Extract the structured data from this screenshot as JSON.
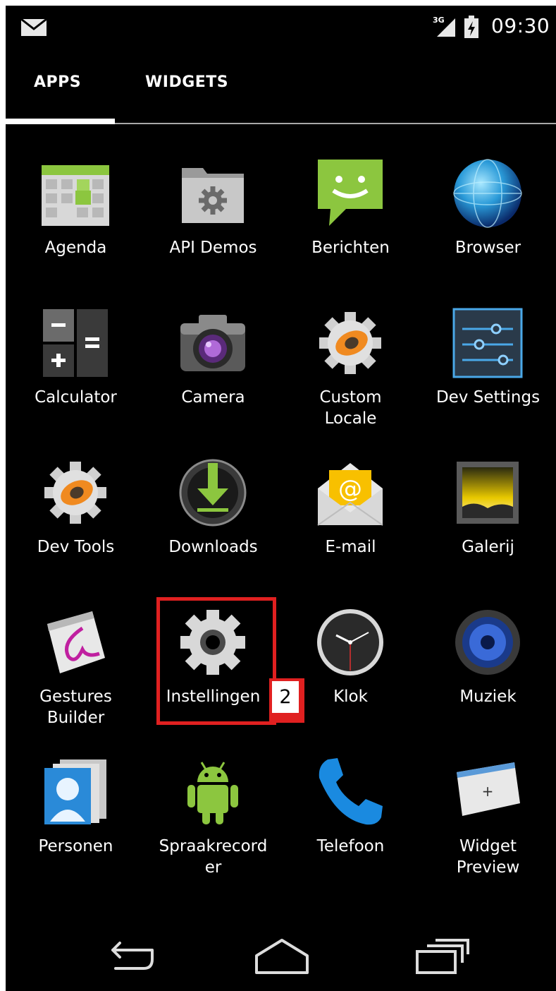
{
  "status_bar": {
    "network": "3G",
    "time": "09:30",
    "icons": [
      "mail-icon",
      "signal-icon",
      "battery-icon"
    ]
  },
  "tabs": [
    {
      "label": "APPS",
      "selected": true
    },
    {
      "label": "WIDGETS",
      "selected": false
    }
  ],
  "apps": [
    {
      "label": "Agenda",
      "icon": "calendar-icon"
    },
    {
      "label": "API Demos",
      "icon": "folder-gear-icon"
    },
    {
      "label": "Berichten",
      "icon": "messaging-icon"
    },
    {
      "label": "Browser",
      "icon": "globe-icon"
    },
    {
      "label": "Calculator",
      "icon": "calculator-icon"
    },
    {
      "label": "Camera",
      "icon": "camera-icon"
    },
    {
      "label": "Custom\nLocale",
      "icon": "gear-orange-icon"
    },
    {
      "label": "Dev Settings",
      "icon": "sliders-icon"
    },
    {
      "label": "Dev Tools",
      "icon": "gear-orange-icon"
    },
    {
      "label": "Downloads",
      "icon": "download-icon"
    },
    {
      "label": "E-mail",
      "icon": "email-icon"
    },
    {
      "label": "Galerij",
      "icon": "gallery-icon"
    },
    {
      "label": "Gestures\nBuilder",
      "icon": "gestures-icon"
    },
    {
      "label": "Instellingen",
      "icon": "settings-gear-icon"
    },
    {
      "label": "Klok",
      "icon": "clock-icon"
    },
    {
      "label": "Muziek",
      "icon": "music-speaker-icon"
    },
    {
      "label": "Personen",
      "icon": "contacts-icon"
    },
    {
      "label": "Spraakrecord\ner",
      "icon": "android-icon"
    },
    {
      "label": "Telefoon",
      "icon": "phone-icon"
    },
    {
      "label": "Widget\nPreview",
      "icon": "widget-preview-icon"
    }
  ],
  "annotation": {
    "badge": "2",
    "color": "#e02020",
    "target": "Instellingen"
  },
  "nav_bar": [
    {
      "label": "back",
      "icon": "back-icon"
    },
    {
      "label": "home",
      "icon": "home-icon"
    },
    {
      "label": "recent apps",
      "icon": "recents-icon"
    }
  ],
  "colors": {
    "background": "#000000",
    "text": "#ffffff",
    "highlight": "#e02020"
  }
}
